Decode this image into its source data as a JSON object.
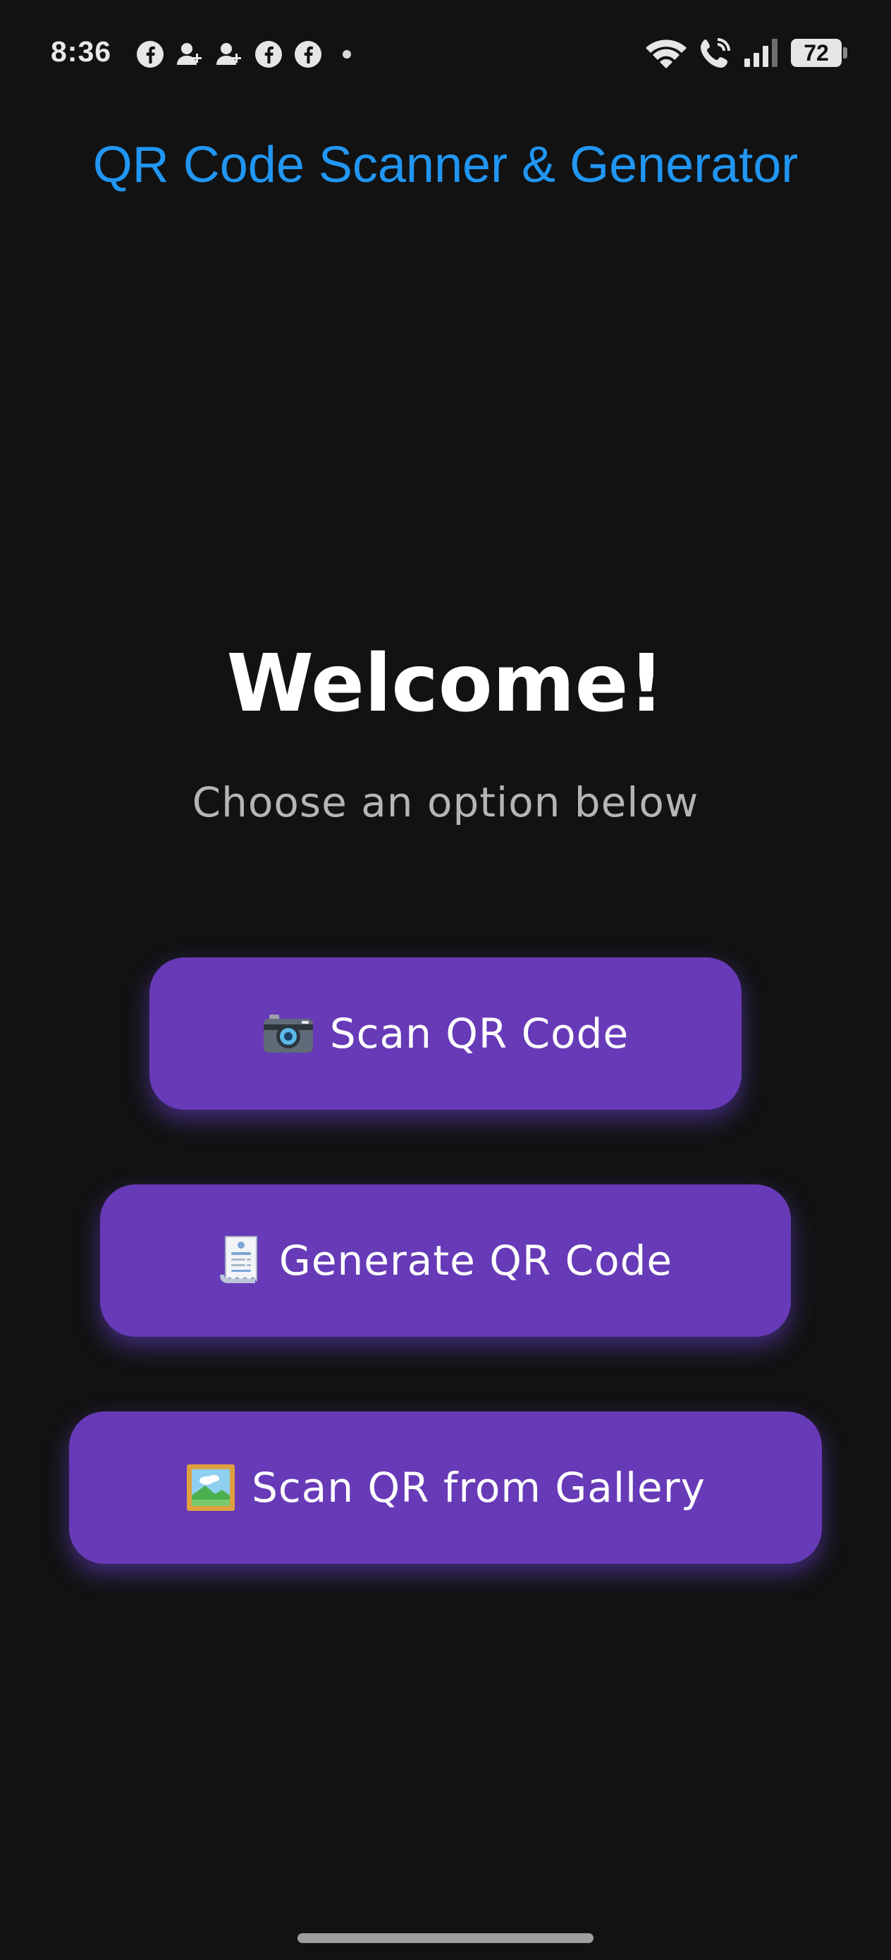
{
  "status_bar": {
    "time": "8:36",
    "battery": "72",
    "notification_icons": [
      "facebook-icon",
      "person-add-icon",
      "person-add-icon",
      "facebook-icon",
      "facebook-icon"
    ],
    "system_icons": [
      "wifi-icon",
      "wifi-call-icon",
      "signal-icon",
      "battery-icon"
    ]
  },
  "app_bar": {
    "title": "QR Code Scanner & Generator"
  },
  "main": {
    "heading": "Welcome!",
    "subheading": "Choose an option below",
    "buttons": [
      {
        "icon": "camera-icon",
        "label": "Scan QR Code"
      },
      {
        "icon": "receipt-icon",
        "label": "Generate QR Code"
      },
      {
        "icon": "framed-picture-icon",
        "label": "Scan QR from Gallery"
      }
    ]
  },
  "colors": {
    "background": "#121212",
    "title": "#2196f3",
    "button": "#673ab7",
    "subtitle": "#b5b5b5"
  }
}
